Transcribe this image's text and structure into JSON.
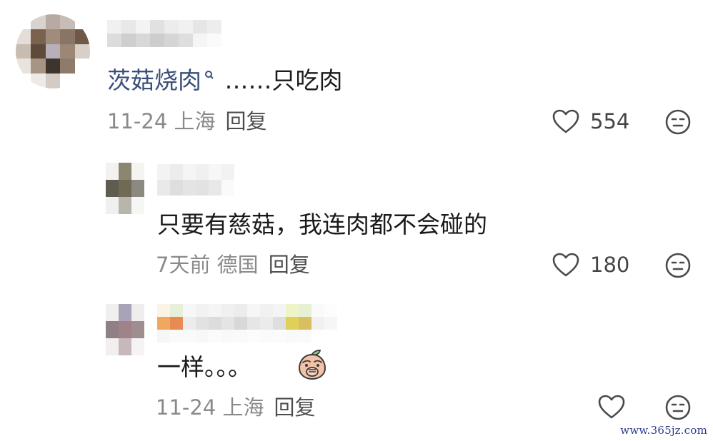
{
  "comments": [
    {
      "mention": "茨菇烧肉",
      "text": " ……只吃肉",
      "date": "11-24",
      "location": "上海",
      "reply_label": "回复",
      "likes": "554"
    },
    {
      "text": "只要有慈菇，我连肉都不会碰的",
      "date": "7天前",
      "location": "德国",
      "reply_label": "回复",
      "likes": "180"
    },
    {
      "text": "一样。。。",
      "date": "11-24",
      "location": "上海",
      "reply_label": "回复",
      "likes": ""
    }
  ],
  "icons": {
    "like": "heart-icon",
    "dislike": "meh-face-icon",
    "mention": "search-icon",
    "emoji": "peach-emoji-icon"
  },
  "colors": {
    "mention": "#3a4f7a",
    "meta": "#8a8a8a",
    "icon_stroke": "#4a4a4a",
    "watermark": "#2c3d8f"
  },
  "watermark": "www.365jz.com"
}
